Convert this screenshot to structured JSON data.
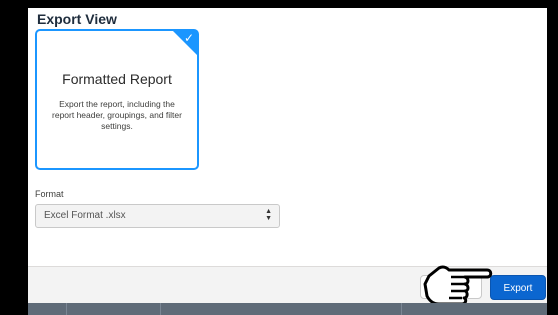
{
  "export_view": {
    "title": "Export View",
    "selected_option": {
      "title": "Formatted Report",
      "description": "Export the report, including the report header, groupings, and filter settings.",
      "selected": true
    },
    "format": {
      "label": "Format",
      "value": "Excel Format .xlsx"
    }
  },
  "footer": {
    "export_label": "Export"
  },
  "colors": {
    "accent": "#1b96ff",
    "primary_button": "#0b66d0"
  },
  "icons": {
    "card_check": "checkmark-icon",
    "select_arrows": "up-down-arrows-icon",
    "pointer": "pointing-hand-icon"
  }
}
